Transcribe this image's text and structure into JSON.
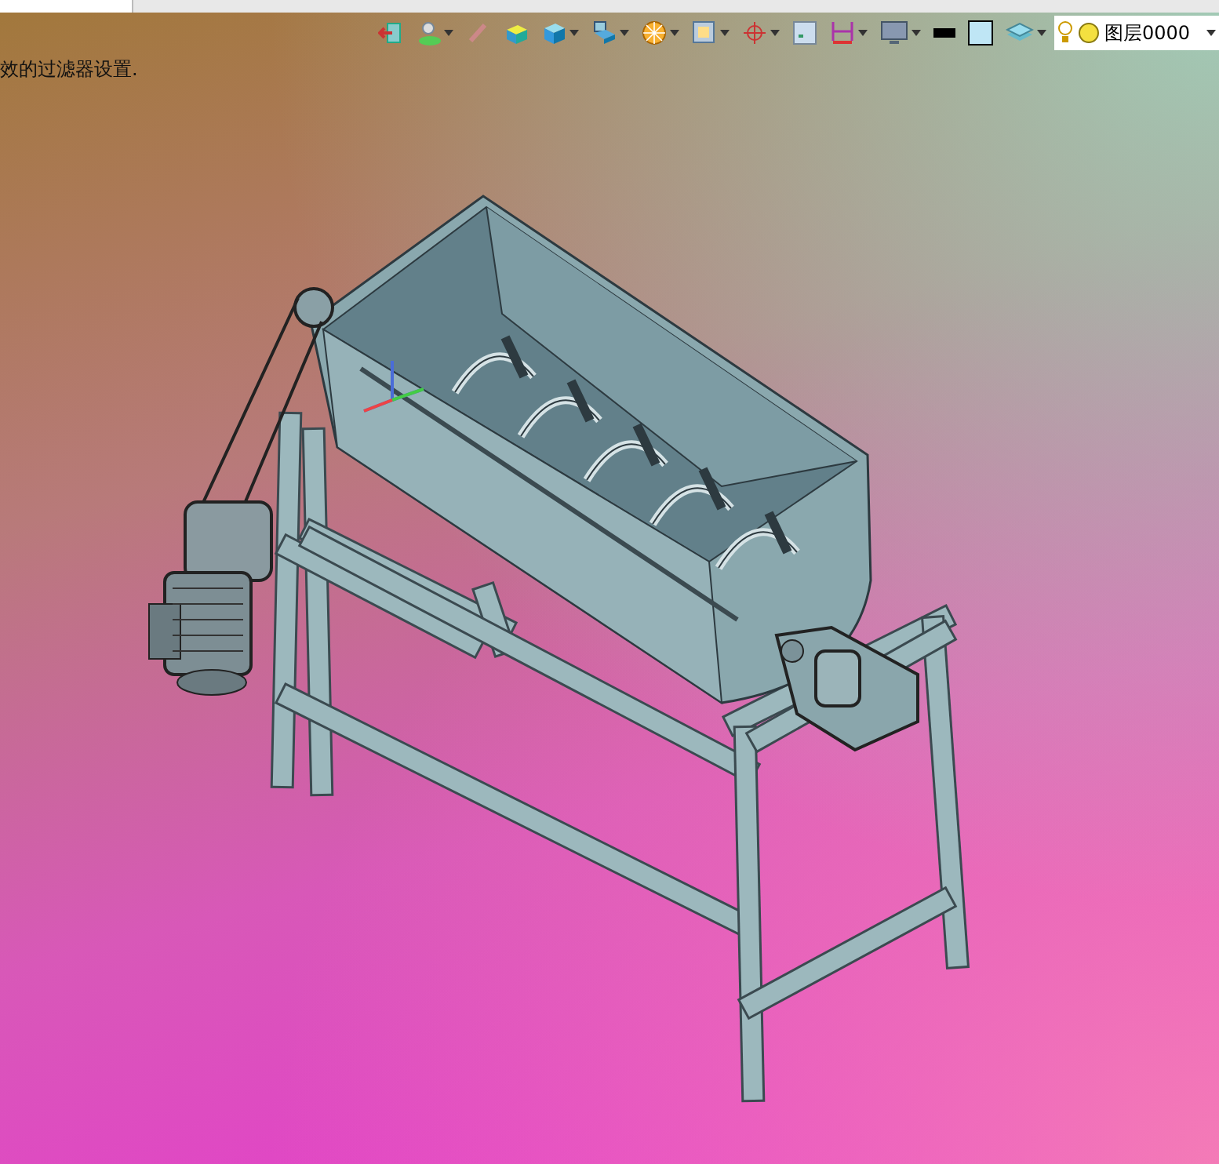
{
  "toolbar": {
    "tools": [
      {
        "dropdown": false
      },
      {
        "dropdown": true
      },
      {
        "dropdown": false
      },
      {
        "dropdown": false
      },
      {
        "dropdown": true
      },
      {
        "dropdown": true
      },
      {
        "dropdown": true
      },
      {
        "dropdown": true
      },
      {
        "dropdown": true
      },
      {
        "dropdown": false
      },
      {
        "dropdown": true
      },
      {
        "dropdown": true
      },
      {
        "dropdown": false
      },
      {
        "dropdown": false
      },
      {
        "dropdown": true
      }
    ],
    "layer": {
      "name": "图层0000"
    }
  },
  "message": "效的过滤器设置."
}
